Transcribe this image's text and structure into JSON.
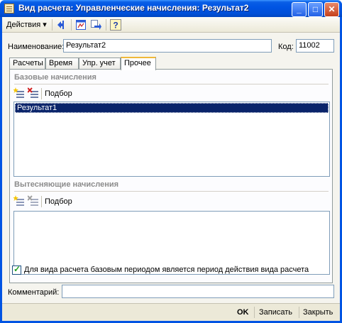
{
  "window": {
    "title": "Вид расчета: Управленческие начисления: Результат2",
    "minimize_glyph": "_",
    "maximize_glyph": "□",
    "close_glyph": "✕"
  },
  "toolbar": {
    "actions_label": "Действия",
    "icons": [
      "move-left-icon",
      "calendar-icon",
      "refresh-icon",
      "help-icon"
    ]
  },
  "form": {
    "name_label": "Наименование:",
    "name_value": "Результат2",
    "code_label": "Код:",
    "code_value": "11002"
  },
  "tabs": [
    {
      "label": "Расчеты",
      "active": false
    },
    {
      "label": "Время",
      "active": false
    },
    {
      "label": "Упр. учет",
      "active": false
    },
    {
      "label": "Прочее",
      "active": true
    }
  ],
  "base_accruals": {
    "title": "Базовые начисления",
    "pick_label": "Подбор",
    "items": [
      "Результат1"
    ]
  },
  "displacing_accruals": {
    "title": "Вытесняющие начисления",
    "pick_label": "Подбор",
    "items": []
  },
  "period_checkbox": {
    "label": "Для вида расчета базовым периодом является период действия вида расчета",
    "checked": true
  },
  "comment": {
    "label": "Комментарий:",
    "value": ""
  },
  "footer": {
    "ok_label": "OK",
    "save_label": "Записать",
    "close_label": "Закрыть"
  }
}
